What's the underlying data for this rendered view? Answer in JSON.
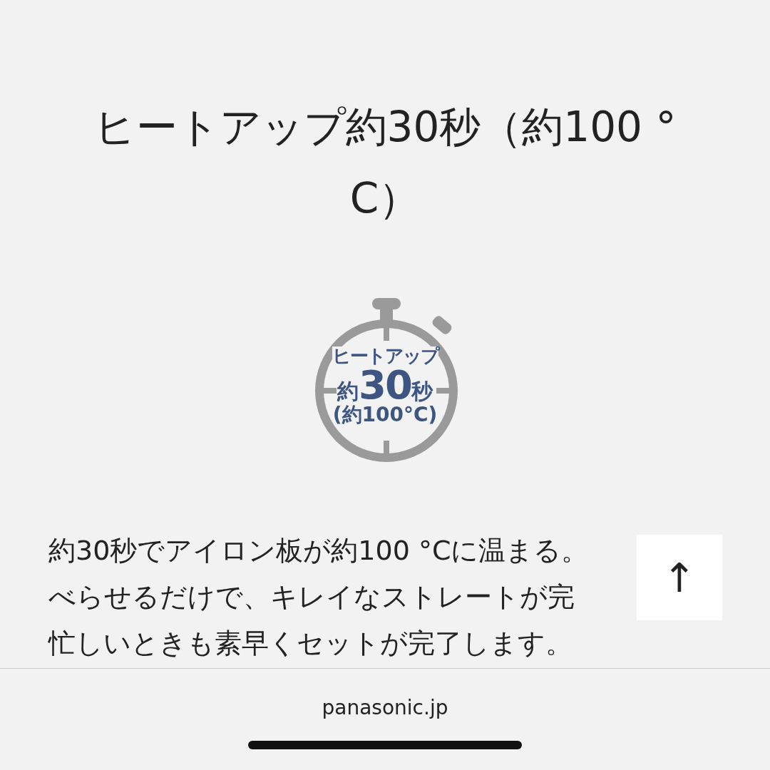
{
  "heading": "ヒートアップ約30秒（約100 °C）",
  "badge": {
    "line_1": "ヒートアップ",
    "prefix": "約",
    "number": "30",
    "suffix": "秒",
    "line_3": "(約100°C)"
  },
  "description_lines": [
    "約30秒でアイロン板が約100 °Cに温まる。",
    "べらせるだけで、キレイなストレートが完",
    "忙しいときも素早くセットが完了します。"
  ],
  "back_to_top": {
    "label": "↑"
  },
  "footer": {
    "domain": "panasonic.jp"
  }
}
